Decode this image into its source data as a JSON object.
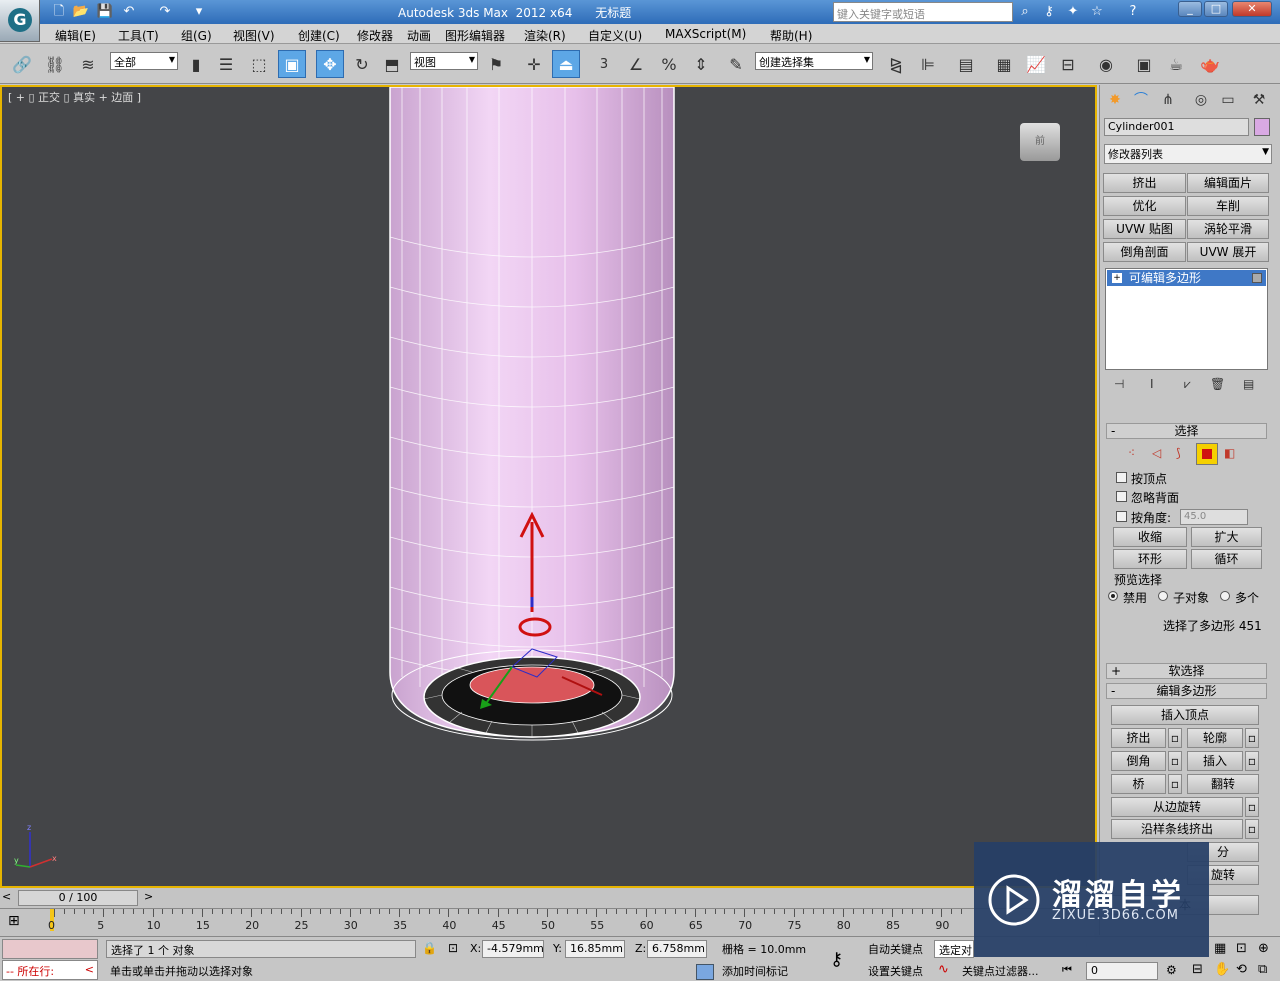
{
  "title": {
    "app": "Autodesk 3ds Max  2012 x64",
    "doc": "无标题"
  },
  "search": {
    "placeholder": "键入关键字或短语"
  },
  "menu": [
    "编辑(E)",
    "工具(T)",
    "组(G)",
    "视图(V)",
    "创建(C)",
    "修改器",
    "动画",
    "图形编辑器",
    "渲染(R)",
    "自定义(U)",
    "MAXScript(M)",
    "帮助(H)"
  ],
  "toolbar": {
    "filter": "全部",
    "refcoord": "视图",
    "selset": "创建选择集",
    "snap_num": "3"
  },
  "viewport": {
    "label": "[ + ▯ 正交 ▯ 真实 + 边面 ]",
    "viewcube": "前"
  },
  "panel": {
    "object_name": "Cylinder001",
    "object_color": "#d9a9e3",
    "modifier_list": "修改器列表",
    "mod_buttons": [
      "挤出",
      "编辑面片",
      "优化",
      "车削",
      "UVW 贴图",
      "涡轮平滑",
      "倒角剖面",
      "UVW 展开"
    ],
    "stack_item": "可编辑多边形",
    "selection": {
      "title": "选择",
      "by_vertex": "按顶点",
      "ignore_back": "忽略背面",
      "by_angle": "按角度:",
      "angle_value": "45.0",
      "shrink": "收缩",
      "grow": "扩大",
      "ring": "环形",
      "loop": "循环",
      "preview": "预览选择",
      "disabled": "禁用",
      "subobject": "子对象",
      "multi": "多个",
      "status": "选择了多边形 451"
    },
    "soft_sel": "软选择",
    "edit_poly": "编辑多边形",
    "insert_vertex": "插入顶点",
    "extrude": "挤出",
    "outline": "轮廓",
    "bevel": "倒角",
    "inset": "插入",
    "bridge": "桥",
    "flip": "翻转",
    "hinge": "从边旋转",
    "spline_extrude": "沿样条线挤出",
    "partial_1": "分",
    "partial_2": "旋转",
    "partial_3": "本"
  },
  "timeline": {
    "frame": "0 / 100",
    "ticks": [
      "0",
      "5",
      "10",
      "15",
      "20",
      "25",
      "30",
      "35",
      "40",
      "45",
      "50",
      "55",
      "60",
      "65",
      "70",
      "75",
      "80",
      "85",
      "90"
    ]
  },
  "status": {
    "line1": "选择了 1 个 对象",
    "line2": "单击或单击并拖动以选择对象",
    "x_label": "X:",
    "x": "-4.579mm",
    "y_label": "Y:",
    "y": "16.85mm",
    "z_label": "Z:",
    "z": "6.758mm",
    "grid": "栅格 = 10.0mm",
    "autokey": "自动关键点",
    "setkey": "设置关键点",
    "selected": "选定对",
    "keyfilter": "关键点过滤器...",
    "addtime": "添加时间标记",
    "running": "-- 所在行:",
    "frame_field": "0"
  },
  "watermark": {
    "name": "溜溜自学",
    "url": "ZIXUE.3D66.COM"
  }
}
